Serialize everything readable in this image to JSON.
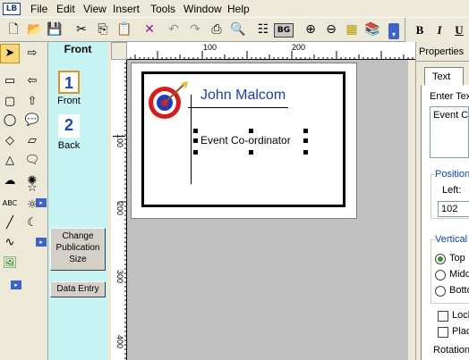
{
  "app": {
    "icon_text": "LB"
  },
  "menu": [
    "File",
    "Edit",
    "View",
    "Insert",
    "Tools",
    "Window",
    "Help"
  ],
  "toolbar": {
    "icons": [
      "new-icon",
      "open-icon",
      "save-icon",
      "cut-icon",
      "copy-icon",
      "paste-icon",
      "delete-icon",
      "undo-icon",
      "redo-icon",
      "print-icon",
      "print-preview-icon",
      "properties-icon",
      "background-icon",
      "zoom-in-icon",
      "zoom-out-icon",
      "grid-icon",
      "library-icon",
      "overflow-icon"
    ],
    "bg_label": "BG",
    "format": {
      "bold": "B",
      "italic": "I",
      "underline": "U"
    }
  },
  "pages": {
    "title": "Front",
    "items": [
      {
        "number": "1",
        "label": "Front",
        "selected": true
      },
      {
        "number": "2",
        "label": "Back",
        "selected": false
      }
    ],
    "change_size_label": "Change Publication Size",
    "data_entry_label": "Data Entry"
  },
  "ruler": {
    "top_labels": [
      "100",
      "200"
    ],
    "left_labels": [
      "100",
      "200",
      "300",
      "400"
    ]
  },
  "card": {
    "name": "John Malcom",
    "title": "Event Co-ordinator",
    "name_color": "#1a3cc8"
  },
  "properties": {
    "title": "Properties",
    "tab": "Text",
    "enter_text_label": "Enter Text",
    "text_value": "Event Co",
    "position_label": "Position",
    "left_label": "Left:",
    "left_value": "102",
    "vertical_label": "Vertical",
    "vertical_options": [
      "Top",
      "Middle",
      "Bottom"
    ],
    "vertical_selected": "Top",
    "lock_label": "Lock",
    "place_label": "Place",
    "rotation_label": "Rotation"
  }
}
